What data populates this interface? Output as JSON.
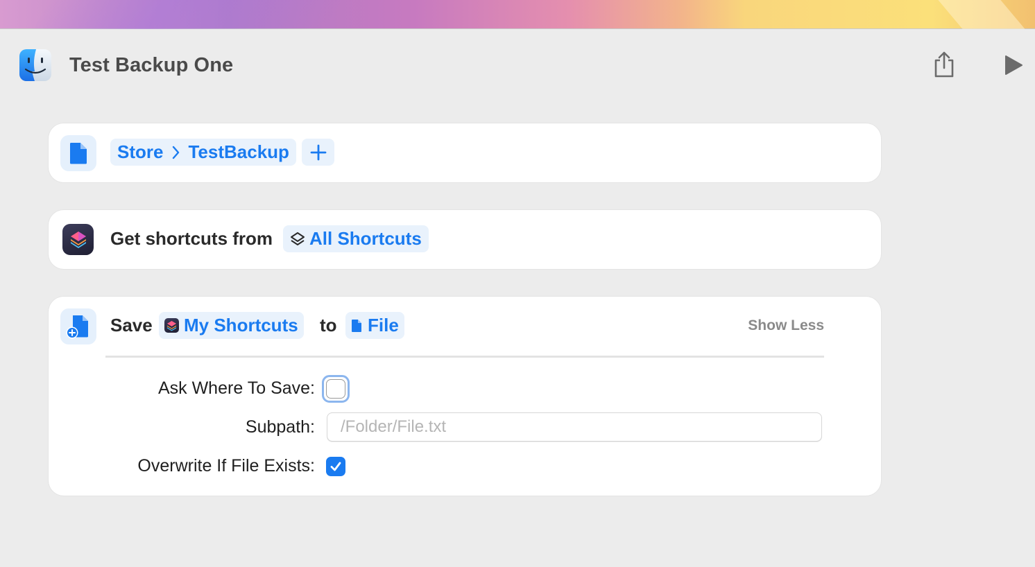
{
  "window": {
    "title": "Test Backup One",
    "app_icon": "finder-icon"
  },
  "toolbar": {
    "share_icon": "share-icon",
    "run_icon": "play-icon"
  },
  "actions": [
    {
      "icon": "document-icon",
      "path_tokens": [
        "Store",
        "TestBackup"
      ],
      "add_label": "+"
    },
    {
      "icon": "shortcuts-app-icon",
      "label": "Get shortcuts from",
      "source_icon": "layers-icon",
      "source": "All Shortcuts"
    },
    {
      "icon": "save-file-icon",
      "verb": "Save",
      "input_icon": "shortcuts-app-icon",
      "input": "My Shortcuts",
      "connector": "to",
      "target_icon": "document-icon",
      "target": "File",
      "toggle_label": "Show Less",
      "params": {
        "ask_label": "Ask Where To Save:",
        "ask_checked": false,
        "subpath_label": "Subpath:",
        "subpath_value": "",
        "subpath_placeholder": "/Folder/File.txt",
        "overwrite_label": "Overwrite If File Exists:",
        "overwrite_checked": true
      }
    }
  ],
  "colors": {
    "accent": "#1a7bf0",
    "token_bg": "#e9f2fc",
    "window_bg": "#ececec"
  }
}
